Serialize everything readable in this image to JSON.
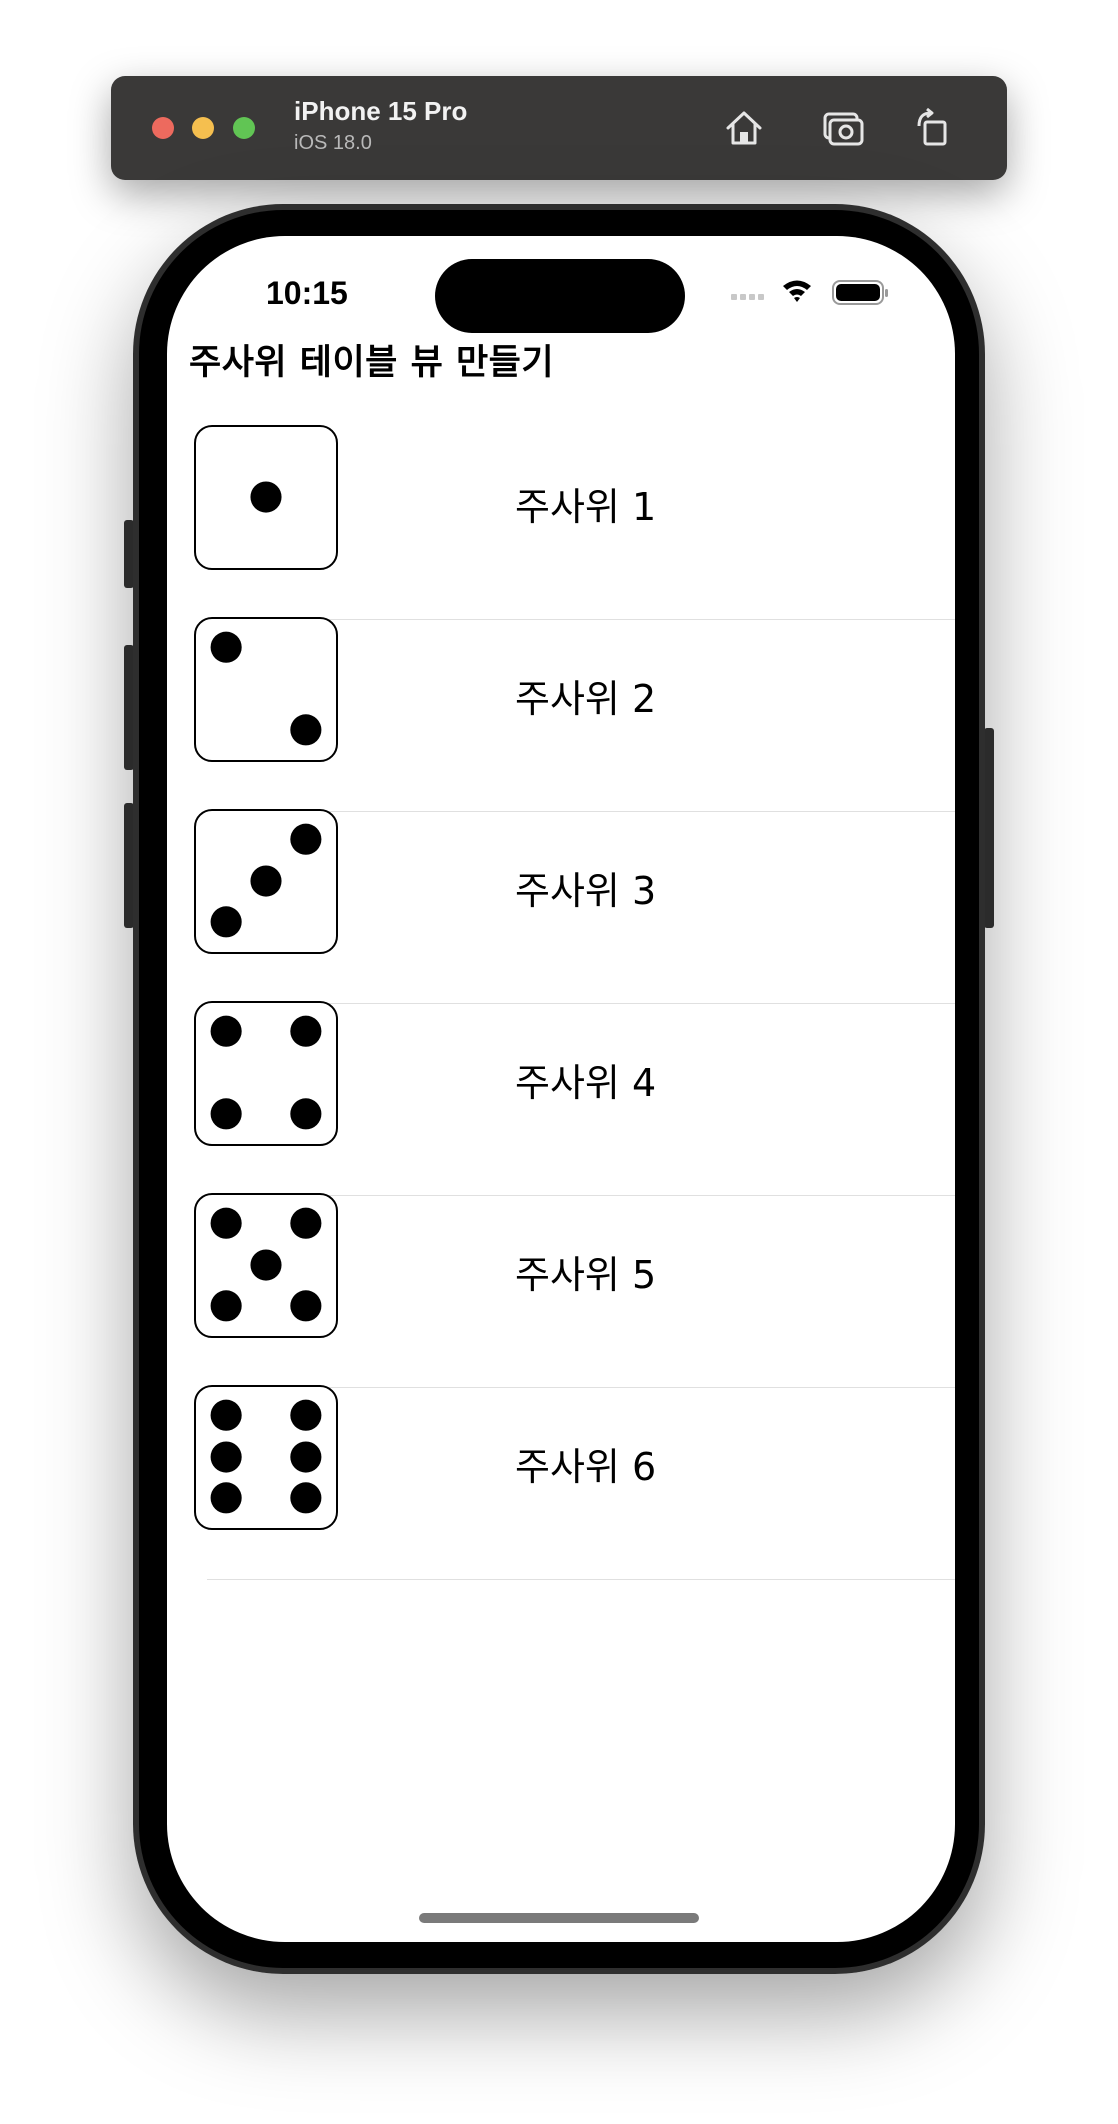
{
  "simulator": {
    "device_name": "iPhone 15 Pro",
    "os_version": "iOS 18.0",
    "buttons": [
      "home-icon",
      "screenshot-icon",
      "rotate-icon"
    ]
  },
  "status_bar": {
    "time": "10:15",
    "icons": [
      "cellular-icon",
      "wifi-icon",
      "battery-icon"
    ]
  },
  "page": {
    "title": "주사위 테이블 뷰 만들기"
  },
  "dice_rows": [
    {
      "label": "주사위 1",
      "pips": 1
    },
    {
      "label": "주사위 2",
      "pips": 2
    },
    {
      "label": "주사위 3",
      "pips": 3
    },
    {
      "label": "주사위 4",
      "pips": 4
    },
    {
      "label": "주사위 5",
      "pips": 5
    },
    {
      "label": "주사위 6",
      "pips": 6
    }
  ]
}
